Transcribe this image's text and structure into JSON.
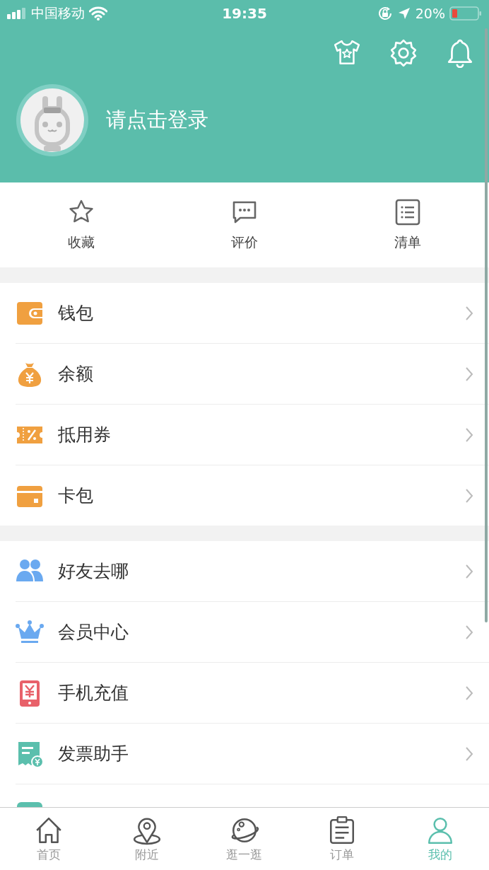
{
  "status_bar": {
    "carrier": "中国移动",
    "time": "19:35",
    "battery": "20%"
  },
  "header": {
    "login_prompt": "请点击登录"
  },
  "quick_actions": [
    {
      "kind": "star",
      "label": "收藏"
    },
    {
      "kind": "comment",
      "label": "评价"
    },
    {
      "kind": "list",
      "label": "清单"
    }
  ],
  "menu_groups": [
    {
      "items": [
        {
          "kind": "wallet",
          "label": "钱包"
        },
        {
          "kind": "moneybag",
          "label": "余额"
        },
        {
          "kind": "coupon",
          "label": "抵用券"
        },
        {
          "kind": "card",
          "label": "卡包"
        }
      ]
    },
    {
      "items": [
        {
          "kind": "friends",
          "label": "好友去哪"
        },
        {
          "kind": "crown",
          "label": "会员中心"
        },
        {
          "kind": "phone",
          "label": "手机充值"
        },
        {
          "kind": "invoice",
          "label": "发票助手"
        },
        {
          "kind": "tealbox"
        }
      ]
    }
  ],
  "tab_bar": [
    {
      "kind": "home",
      "label": "首页",
      "selected": false
    },
    {
      "kind": "pin",
      "label": "附近",
      "selected": false
    },
    {
      "kind": "planet",
      "label": "逛一逛",
      "selected": false
    },
    {
      "kind": "clipboard",
      "label": "订单",
      "selected": false
    },
    {
      "kind": "person",
      "label": "我的",
      "selected": true
    }
  ]
}
